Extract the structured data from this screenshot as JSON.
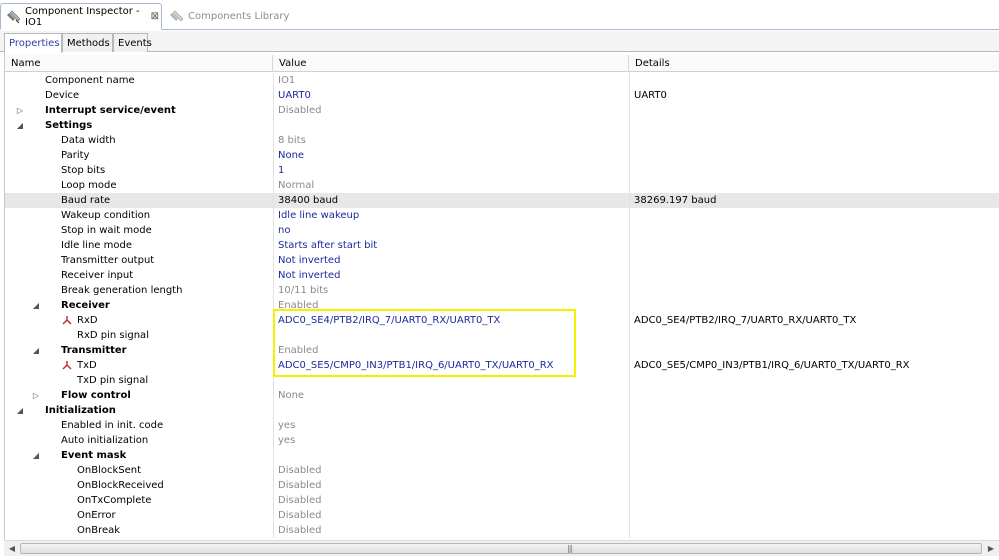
{
  "editor_tabs": [
    {
      "label": "Component Inspector - IO1",
      "active": true
    },
    {
      "label": "Components Library",
      "active": false
    }
  ],
  "property_tabs": [
    "Properties",
    "Methods",
    "Events"
  ],
  "columns": [
    "Name",
    "Value",
    "Details"
  ],
  "rows": [
    {
      "name": "Component name",
      "value": "IO1",
      "details": "",
      "indent": 2,
      "bold": false,
      "expander": "",
      "value_style": "gray"
    },
    {
      "name": "Device",
      "value": "UART0",
      "details": "UART0",
      "indent": 2,
      "bold": false,
      "expander": "",
      "value_style": "blue"
    },
    {
      "name": "Interrupt service/event",
      "value": "Disabled",
      "details": "",
      "indent": 2,
      "bold": true,
      "expander": "collapsed",
      "value_style": "gray"
    },
    {
      "name": "Settings",
      "value": "",
      "details": "",
      "indent": 2,
      "bold": true,
      "expander": "expanded",
      "value_style": "gray"
    },
    {
      "name": "Data width",
      "value": "8 bits",
      "details": "",
      "indent": 3,
      "bold": false,
      "expander": "",
      "value_style": "gray"
    },
    {
      "name": "Parity",
      "value": "None",
      "details": "",
      "indent": 3,
      "bold": false,
      "expander": "",
      "value_style": "blue"
    },
    {
      "name": "Stop bits",
      "value": "1",
      "details": "",
      "indent": 3,
      "bold": false,
      "expander": "",
      "value_style": "blue"
    },
    {
      "name": "Loop mode",
      "value": "Normal",
      "details": "",
      "indent": 3,
      "bold": false,
      "expander": "",
      "value_style": "gray"
    },
    {
      "name": "Baud rate",
      "value": "38400 baud",
      "details": "38269.197 baud",
      "indent": 3,
      "bold": false,
      "expander": "",
      "value_style": "black",
      "selected": true
    },
    {
      "name": "Wakeup condition",
      "value": "Idle line wakeup",
      "details": "",
      "indent": 3,
      "bold": false,
      "expander": "",
      "value_style": "blue"
    },
    {
      "name": "Stop in wait mode",
      "value": "no",
      "details": "",
      "indent": 3,
      "bold": false,
      "expander": "",
      "value_style": "blue"
    },
    {
      "name": "Idle line mode",
      "value": "Starts after start bit",
      "details": "",
      "indent": 3,
      "bold": false,
      "expander": "",
      "value_style": "blue"
    },
    {
      "name": "Transmitter output",
      "value": "Not inverted",
      "details": "",
      "indent": 3,
      "bold": false,
      "expander": "",
      "value_style": "blue"
    },
    {
      "name": "Receiver input",
      "value": "Not inverted",
      "details": "",
      "indent": 3,
      "bold": false,
      "expander": "",
      "value_style": "blue"
    },
    {
      "name": "Break generation length",
      "value": "10/11 bits",
      "details": "",
      "indent": 3,
      "bold": false,
      "expander": "",
      "value_style": "gray"
    },
    {
      "name": "Receiver",
      "value": "Enabled",
      "details": "",
      "indent": 3,
      "bold": true,
      "expander": "expanded",
      "value_style": "gray"
    },
    {
      "name": "RxD",
      "value": "ADC0_SE4/PTB2/IRQ_7/UART0_RX/UART0_TX",
      "details": "ADC0_SE4/PTB2/IRQ_7/UART0_RX/UART0_TX",
      "indent": 4,
      "bold": false,
      "expander": "",
      "value_style": "blue",
      "pin_icon": true
    },
    {
      "name": "RxD pin signal",
      "value": "",
      "details": "",
      "indent": 5,
      "bold": false,
      "expander": "",
      "value_style": "gray"
    },
    {
      "name": "Transmitter",
      "value": "Enabled",
      "details": "",
      "indent": 3,
      "bold": true,
      "expander": "expanded",
      "value_style": "gray"
    },
    {
      "name": "TxD",
      "value": "ADC0_SE5/CMP0_IN3/PTB1/IRQ_6/UART0_TX/UART0_RX",
      "details": "ADC0_SE5/CMP0_IN3/PTB1/IRQ_6/UART0_TX/UART0_RX",
      "indent": 4,
      "bold": false,
      "expander": "",
      "value_style": "blue",
      "pin_icon": true
    },
    {
      "name": "TxD pin signal",
      "value": "",
      "details": "",
      "indent": 5,
      "bold": false,
      "expander": "",
      "value_style": "gray"
    },
    {
      "name": "Flow control",
      "value": "None",
      "details": "",
      "indent": 3,
      "bold": true,
      "expander": "collapsed",
      "value_style": "gray"
    },
    {
      "name": "Initialization",
      "value": "",
      "details": "",
      "indent": 2,
      "bold": true,
      "expander": "expanded",
      "value_style": "gray"
    },
    {
      "name": "Enabled in init. code",
      "value": "yes",
      "details": "",
      "indent": 3,
      "bold": false,
      "expander": "",
      "value_style": "gray"
    },
    {
      "name": "Auto initialization",
      "value": "yes",
      "details": "",
      "indent": 3,
      "bold": false,
      "expander": "",
      "value_style": "gray"
    },
    {
      "name": "Event mask",
      "value": "",
      "details": "",
      "indent": 3,
      "bold": true,
      "expander": "expanded",
      "value_style": "gray"
    },
    {
      "name": "OnBlockSent",
      "value": "Disabled",
      "details": "",
      "indent": 5,
      "bold": false,
      "expander": "",
      "value_style": "gray"
    },
    {
      "name": "OnBlockReceived",
      "value": "Disabled",
      "details": "",
      "indent": 5,
      "bold": false,
      "expander": "",
      "value_style": "gray"
    },
    {
      "name": "OnTxComplete",
      "value": "Disabled",
      "details": "",
      "indent": 5,
      "bold": false,
      "expander": "",
      "value_style": "gray"
    },
    {
      "name": "OnError",
      "value": "Disabled",
      "details": "",
      "indent": 5,
      "bold": false,
      "expander": "",
      "value_style": "gray"
    },
    {
      "name": "OnBreak",
      "value": "Disabled",
      "details": "",
      "indent": 5,
      "bold": false,
      "expander": "",
      "value_style": "gray"
    }
  ],
  "colors": {
    "value_blue": "#1b2b9c",
    "value_gray": "#8a8a8a",
    "highlight": "#f4f000",
    "active_tab": "#2b3fa8"
  }
}
